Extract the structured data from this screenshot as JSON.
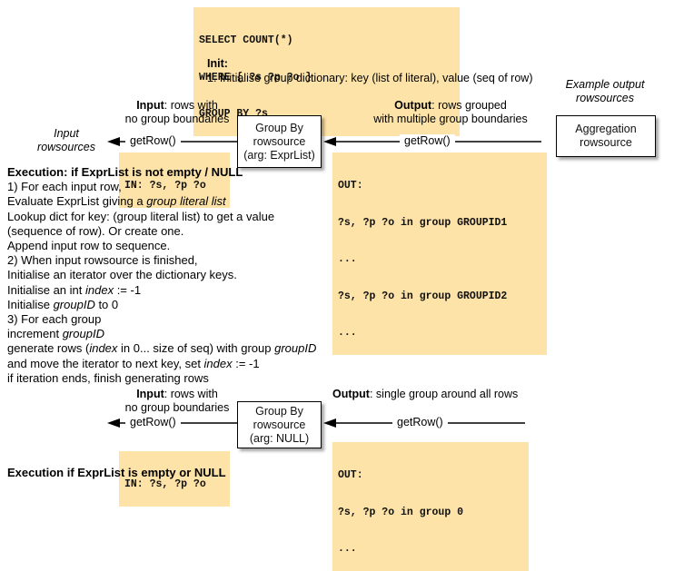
{
  "query": {
    "lines": [
      "SELECT COUNT(*)",
      "WHERE { ?s ?p ?o }",
      "GROUP BY ?s"
    ]
  },
  "init": {
    "heading": "Init:",
    "step1": "1. Initialise group dictionary: key (list of literal), value (seq of row)"
  },
  "example_output_label": {
    "line1": "Example output",
    "line2": "rowsources"
  },
  "diagram1": {
    "input_label": {
      "line1_strong": "Input",
      "line1_rest": ": rows with",
      "line2": "no group boundaries"
    },
    "output_label": {
      "line1_strong": "Output",
      "line1_rest": ": rows grouped",
      "line2": "with multiple group boundaries"
    },
    "left_arrow_label": "getRow()",
    "right_arrow_label": "getRow()",
    "input_rowsources_label": {
      "line1": "Input",
      "line2": "rowsources"
    },
    "node": {
      "line1": "Group By",
      "line2": "rowsource",
      "line3": "(arg: ExprList)"
    },
    "aggregation_node": {
      "line1": "Aggregation",
      "line2": "rowsource"
    },
    "in_block": [
      "IN: ?s, ?p ?o"
    ],
    "out_block": [
      "OUT:",
      "?s, ?p ?o in group GROUPID1",
      "...",
      "?s, ?p ?o in group GROUPID2",
      "..."
    ]
  },
  "execution1": {
    "lines": [
      {
        "text": "Execution: if ExprList is not empty / NULL",
        "bold": true
      },
      {
        "text": "1) For each input row,",
        "bold": false
      },
      {
        "text": "Evaluate ExprList giving a |group literal list|",
        "bold": false
      },
      {
        "text": "Lookup dict for key: (group literal list) to get a value",
        "bold": false
      },
      {
        "text": "(sequence of row).  Or create one.",
        "bold": false
      },
      {
        "text": "Append input row to sequence.",
        "bold": false
      },
      {
        "text": "2) When input rowsource is finished,",
        "bold": false
      },
      {
        "text": "Initialise an iterator over the dictionary keys.",
        "bold": false
      },
      {
        "text": "Initialise an int |index| := -1",
        "bold": false
      },
      {
        "text": "Initialise |groupID| to 0",
        "bold": false
      },
      {
        "text": "3) For each group",
        "bold": false
      },
      {
        "text": "increment |groupID|",
        "bold": false
      },
      {
        "text": "generate rows (|index| in 0... size of seq) with group |groupID|",
        "bold": false
      },
      {
        "text": "and move the iterator to next key, set |index| := -1",
        "bold": false
      },
      {
        "text": "if iteration ends, finish generating rows",
        "bold": false
      }
    ]
  },
  "diagram2": {
    "input_label": {
      "line1_strong": "Input",
      "line1_rest": ": rows with",
      "line2": "no group boundaries"
    },
    "output_label": {
      "line1_strong": "Output",
      "line1_rest": ": single group around all rows"
    },
    "left_arrow_label": "getRow()",
    "right_arrow_label": "getRow()",
    "node": {
      "line1": "Group By",
      "line2": "rowsource",
      "line3": "(arg: NULL)"
    },
    "in_block": [
      "IN: ?s, ?p ?o"
    ],
    "out_block": [
      "OUT:",
      "?s, ?p ?o in group 0",
      "..."
    ]
  },
  "execution2": {
    "heading": "Execution if ExprList is empty or NULL"
  },
  "colors": {
    "highlight": "#fde3a7",
    "ink": "#000000",
    "page": "#ffffff"
  }
}
